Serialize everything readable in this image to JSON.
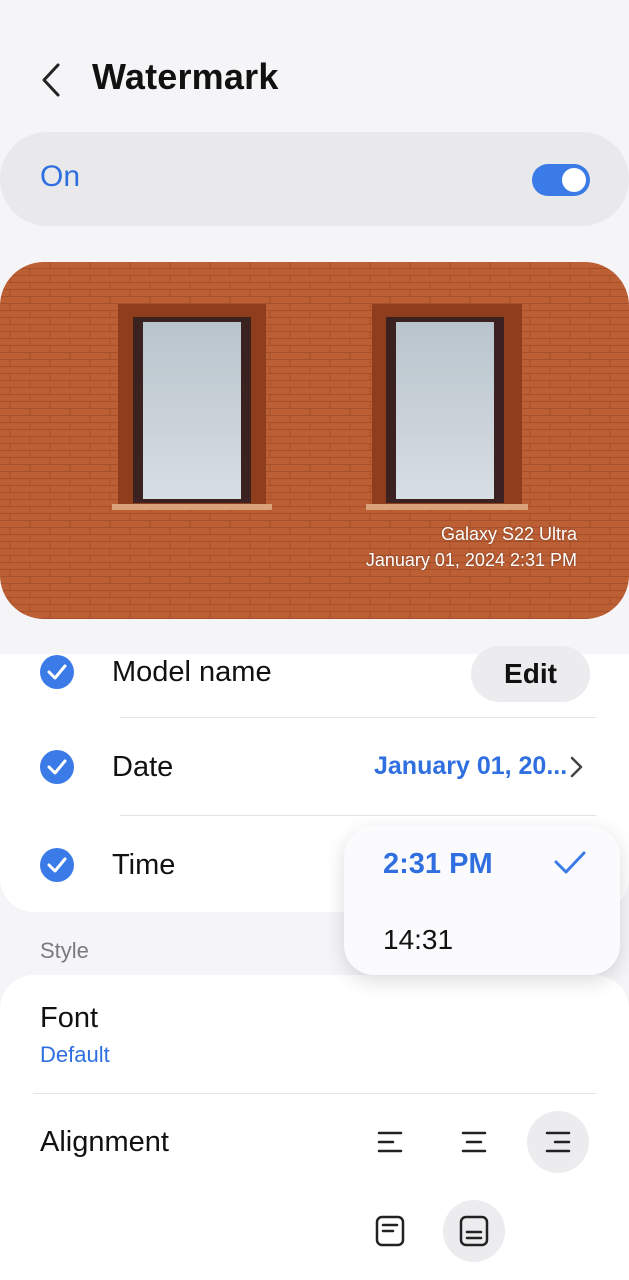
{
  "header": {
    "title": "Watermark"
  },
  "master_toggle": {
    "label": "On",
    "state": "on",
    "accent": "#3a7be8"
  },
  "preview": {
    "watermark_model": "Galaxy S22 Ultra",
    "watermark_datetime": "January 01, 2024 2:31 PM"
  },
  "options": {
    "model_name": {
      "label": "Model name",
      "checked": true,
      "action": "Edit"
    },
    "date": {
      "label": "Date",
      "checked": true,
      "value": "January 01, 20..."
    },
    "time": {
      "label": "Time",
      "checked": true
    }
  },
  "time_format_menu": {
    "options": [
      {
        "label": "2:31 PM",
        "selected": true
      },
      {
        "label": "14:31",
        "selected": false
      }
    ]
  },
  "style": {
    "section_label": "Style",
    "font": {
      "label": "Font",
      "value": "Default"
    },
    "alignment": {
      "label": "Alignment",
      "horizontal_selected": "right",
      "vertical_selected": "bottom"
    }
  },
  "colors": {
    "accent": "#3a7be8",
    "link": "#2f6fdf",
    "brick": "#b75a31"
  }
}
